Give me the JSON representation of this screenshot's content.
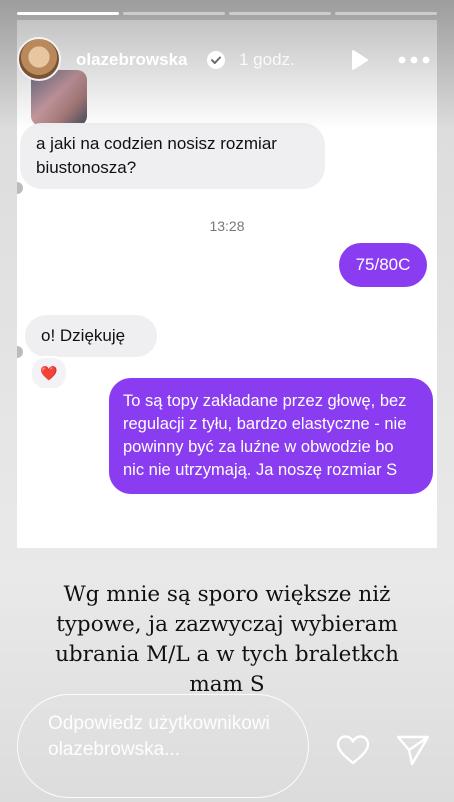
{
  "story": {
    "progress": [
      1.0,
      0.0,
      0.0,
      0.0
    ],
    "username": "olazebrowska",
    "time_ago": "1 godz.",
    "verified": true
  },
  "chat": {
    "msg_question": "a jaki na codzien nosisz rozmiar biustonosza?",
    "timestamp": "13:28",
    "msg_size": "75/80C",
    "msg_thanks": "o! Dziękuję",
    "reaction": "❤️",
    "msg_info": "To są topy zakładane przez głowę, bez regulacji z tyłu, bardzo elastyczne - nie powinny być za luźne w obwodzie bo nic nie utrzymają. Ja noszę rozmiar S"
  },
  "caption": "Wg mnie są sporo większe niż typowe, ja zazwyczaj wybieram ubrania M/L a w tych braletkch mam S",
  "reply": {
    "placeholder": "Odpowiedz użytkownikowi olazebrowska..."
  },
  "colors": {
    "sent_bubble": "#8a3cf0",
    "received_bubble": "#efeff1"
  },
  "icons": [
    "verified-badge-icon",
    "play-icon",
    "more-icon",
    "heart-icon",
    "send-icon"
  ]
}
